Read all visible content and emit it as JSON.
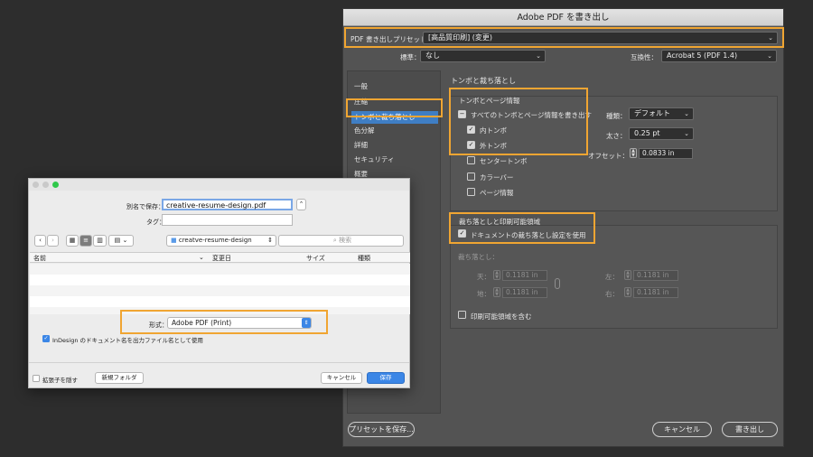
{
  "pdf_dialog": {
    "title": "Adobe PDF を書き出し",
    "preset_label": "PDF 書き出しプリセット：",
    "preset_value": "[高品質印刷] (変更)",
    "standard_label": "標準：",
    "standard_value": "なし",
    "compat_label": "互換性：",
    "compat_value": "Acrobat 5 (PDF 1.4)",
    "nav": [
      "一般",
      "圧縮",
      "トンボと裁ち落とし",
      "色分解",
      "詳細",
      "セキュリティ",
      "概要"
    ],
    "section_title": "トンボと裁ち落とし",
    "marks_group_title": "トンボとページ情報",
    "all_marks_label": "すべてのトンボとページ情報を書き出す",
    "marks": [
      {
        "label": "内トンボ",
        "checked": true
      },
      {
        "label": "外トンボ",
        "checked": true
      },
      {
        "label": "センタートンボ",
        "checked": false
      },
      {
        "label": "カラーバー",
        "checked": false
      },
      {
        "label": "ページ情報",
        "checked": false
      }
    ],
    "kind_label": "種類：",
    "kind_value": "デフォルト",
    "weight_label": "太さ：",
    "weight_value": "0.25 pt",
    "offset_label": "オフセット：",
    "offset_value": "0.0833 in",
    "bleed_group_title": "裁ち落としと印刷可能領域",
    "use_doc_bleed_label": "ドキュメントの裁ち落とし設定を使用",
    "bleed_label": "裁ち落とし：",
    "bleed": {
      "top_label": "天：",
      "top": "0.1181 in",
      "bottom_label": "地：",
      "bottom": "0.1181 in",
      "left_label": "左：",
      "left": "0.1181 in",
      "right_label": "右：",
      "right": "0.1181 in"
    },
    "slug_label": "印刷可能領域を含む",
    "save_preset_btn": "プリセットを保存...",
    "cancel_btn": "キャンセル",
    "export_btn": "書き出し"
  },
  "save_dialog": {
    "save_as_label": "別名で保存：",
    "filename": "creative-resume-design.pdf",
    "tags_label": "タグ：",
    "folder": "creatve-resume-design",
    "search_placeholder": "検索",
    "columns": [
      "名前",
      "変更日",
      "サイズ",
      "種類"
    ],
    "format_label": "形式：",
    "format_value": "Adobe PDF (Print)",
    "use_indesign_name_label": "InDesign のドキュメント名を出力ファイル名として使用",
    "hide_ext_label": "拡張子を隠す",
    "new_folder_btn": "新規フォルダ",
    "cancel_btn": "キャンセル",
    "save_btn": "保存"
  },
  "colors": {
    "highlight": "#f0a532",
    "selection": "#3f7ec4",
    "save_button": "#3b86e6"
  }
}
